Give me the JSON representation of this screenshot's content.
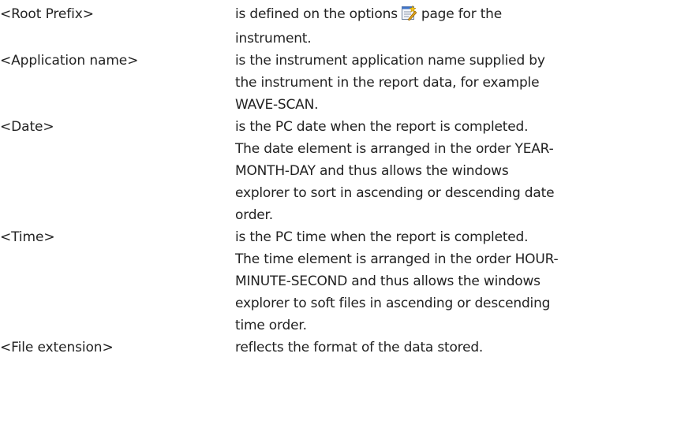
{
  "colors": {
    "text": "#222222",
    "background": "#ffffff"
  },
  "definitions": [
    {
      "term": "<Root Prefix>",
      "lines": {
        "l1a": "is defined on the options",
        "icon": "options-page-icon",
        "l1b": "page for the",
        "l2": "instrument."
      }
    },
    {
      "term": "<Application name>",
      "lines": [
        "is the instrument application name supplied by",
        "the instrument in the report data, for example",
        "WAVE-SCAN."
      ]
    },
    {
      "term": "<Date>",
      "lines": [
        "is the PC date when the report is completed.",
        "The date element is arranged in the order YEAR-",
        "MONTH-DAY and thus allows the windows",
        "explorer to sort in ascending or descending date",
        "order."
      ]
    },
    {
      "term": "<Time>",
      "lines": [
        "is the PC time when the report is completed.",
        "The time element is arranged in the order HOUR-",
        "MINUTE-SECOND and thus allows the windows",
        "explorer to soft files in ascending or descending",
        "time order."
      ]
    },
    {
      "term": "<File extension>",
      "lines": [
        "reflects the format of the data stored."
      ]
    }
  ]
}
